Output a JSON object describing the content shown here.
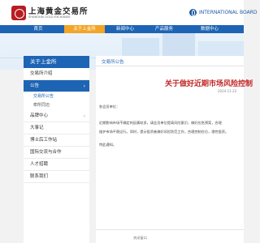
{
  "header": {
    "logo_cn": "上海黄金交易所",
    "logo_en": "SHANGHAI GOLD EXCHANGE",
    "intl_link": "INTERNATIONAL BOARD"
  },
  "nav": [
    {
      "label": "首页"
    },
    {
      "label": "关于上金所",
      "active": true
    },
    {
      "label": "新闻中心"
    },
    {
      "label": "产品服务"
    },
    {
      "label": "数据中心"
    }
  ],
  "sidebar": {
    "heading": "关于上金所",
    "items": [
      {
        "label": "交易所介绍"
      },
      {
        "label": "公告",
        "active": true
      },
      {
        "label": "品牌中心"
      },
      {
        "label": "大事记"
      },
      {
        "label": "博士后工作站"
      },
      {
        "label": "国际交流与合作"
      },
      {
        "label": "人才招聘"
      },
      {
        "label": "联系我们"
      }
    ],
    "subitems": [
      {
        "label": "交易所公告",
        "current": true
      },
      {
        "label": "牵所同迈"
      }
    ]
  },
  "content": {
    "breadcrumb": "交易所公告",
    "title": "关于做好近期市场风险控制",
    "date": "2024-11-22",
    "greeting": "各会员单位：",
    "body_line_1": "近期影响市场不确定的因素较多，请会员单位提高风险意识，做好应急预案，合理",
    "body_line_2": "维护市场平稳运行。同时，提示投资者做好风险防范工作，合理控制仓位，理性投资。",
    "closing": "特此通知。",
    "footer_text": "关闭窗口"
  }
}
